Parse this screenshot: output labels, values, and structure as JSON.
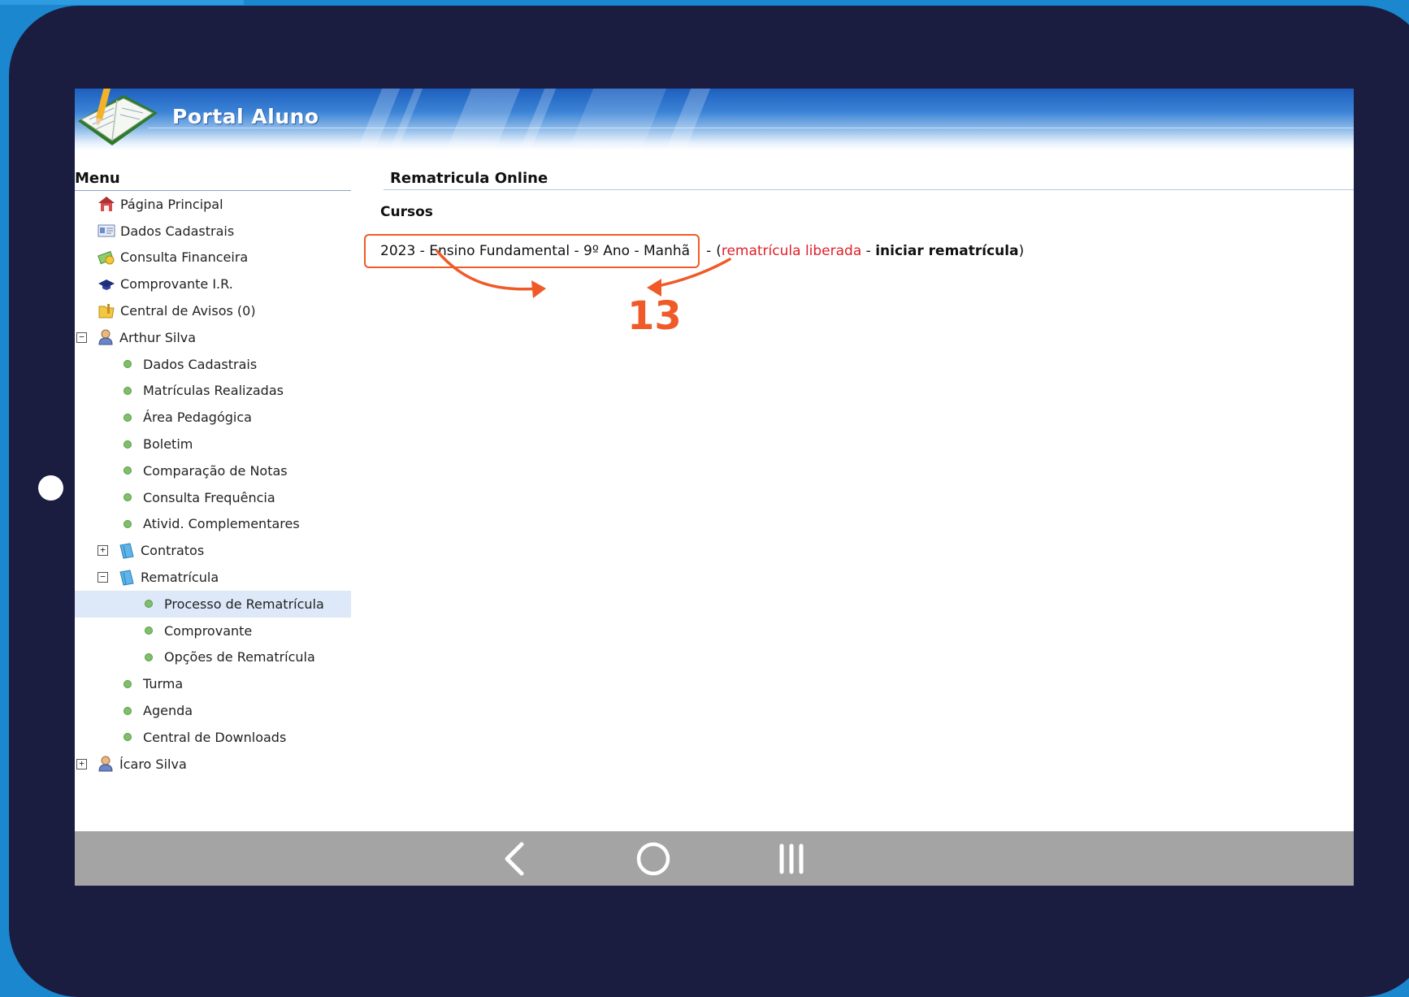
{
  "app": {
    "title": "Portal Aluno"
  },
  "sidebar": {
    "heading": "Menu",
    "items": [
      {
        "label": "Página Principal",
        "icon": "house-icon"
      },
      {
        "label": "Dados Cadastrais",
        "icon": "id-card-icon"
      },
      {
        "label": "Consulta Financeira",
        "icon": "money-icon"
      },
      {
        "label": "Comprovante I.R.",
        "icon": "tax-receipt-icon"
      },
      {
        "label": "Central de Avisos (0)",
        "icon": "folder-icon"
      },
      {
        "label": "Arthur Silva",
        "icon": "user-icon"
      },
      {
        "label": "Dados Cadastrais"
      },
      {
        "label": "Matrículas Realizadas"
      },
      {
        "label": "Área Pedagógica"
      },
      {
        "label": "Boletim"
      },
      {
        "label": "Comparação de Notas"
      },
      {
        "label": "Consulta Frequência"
      },
      {
        "label": "Ativid. Complementares"
      },
      {
        "label": "Contratos",
        "icon": "book-icon"
      },
      {
        "label": "Rematrícula",
        "icon": "book-icon"
      },
      {
        "label": "Processo de Rematrícula"
      },
      {
        "label": "Comprovante"
      },
      {
        "label": "Opções de Rematrícula"
      },
      {
        "label": "Turma"
      },
      {
        "label": "Agenda"
      },
      {
        "label": "Central de Downloads"
      },
      {
        "label": "Ícaro Silva",
        "icon": "user-icon"
      }
    ]
  },
  "main": {
    "heading": "Rematricula Online",
    "section": "Cursos",
    "course": {
      "label": "2023 - Ensino Fundamental - 9º Ano - Manhã",
      "separator": "-",
      "open_paren": "(",
      "status": "rematrícula liberada",
      "dash": " - ",
      "action": "iniciar rematrícula",
      "close_paren": ")"
    },
    "step_number": "13"
  },
  "colors": {
    "accent": "#f05a28",
    "status_red": "#e0202a",
    "tablet_frame": "#1a1c40",
    "background": "#1a87cf",
    "nav_bar": "#a4a4a4"
  },
  "navbar": {
    "back_icon": "chevron-left-icon",
    "home_icon": "circle-home-icon",
    "recent_icon": "recent-apps-icon"
  }
}
